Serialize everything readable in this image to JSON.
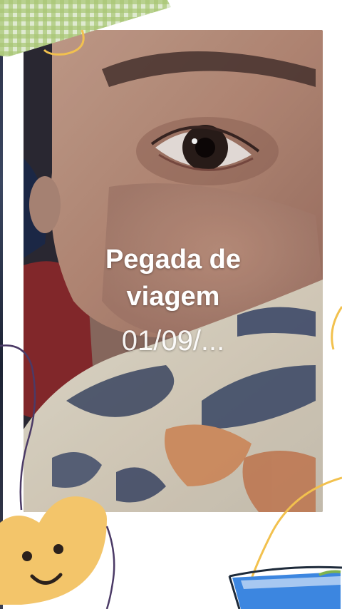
{
  "story": {
    "title_line1": "Pegada de",
    "title_line2": "viagem",
    "date_text": "01/09/..."
  },
  "colors": {
    "background": "#ffffff",
    "caption_text": "#ffffff",
    "heart": "#f3c56a",
    "gingham": "#a9c774",
    "doodle_line": "#f2c14e",
    "doodle_purple": "#4b3a66",
    "water": "#3c86e0"
  },
  "decorations": [
    "gingham-tape",
    "heart-face-sticker",
    "water-bowl-sticker",
    "yellow-doodle-line",
    "purple-doodle-line"
  ]
}
